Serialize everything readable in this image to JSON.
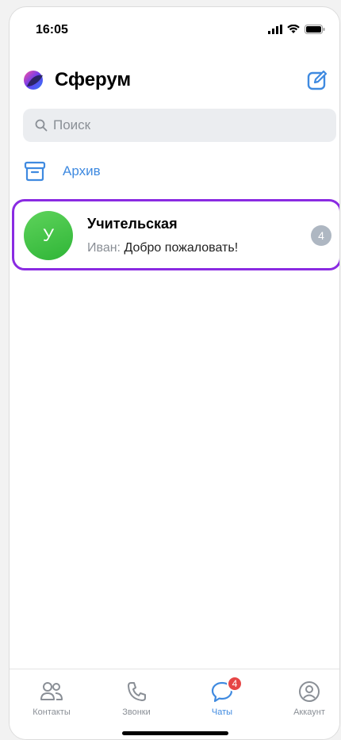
{
  "status_bar": {
    "time": "16:05"
  },
  "header": {
    "title": "Сферум",
    "logo_icon": "sferum-logo",
    "compose_icon": "compose-icon"
  },
  "search": {
    "placeholder": "Поиск"
  },
  "archive": {
    "label": "Архив"
  },
  "chats": [
    {
      "avatar_letter": "У",
      "title": "Учительская",
      "sender": "Иван:",
      "message": "Добро пожаловать!",
      "unread": "4",
      "highlighted": true
    }
  ],
  "tabbar": {
    "tabs": [
      {
        "label": "Контакты",
        "icon": "contacts-icon"
      },
      {
        "label": "Звонки",
        "icon": "phone-icon"
      },
      {
        "label": "Чаты",
        "icon": "chat-icon",
        "badge": "4",
        "active": true
      },
      {
        "label": "Аккаунт",
        "icon": "account-icon"
      }
    ]
  },
  "colors": {
    "accent": "#3f8ae0",
    "highlight": "#8a2be2",
    "avatar": "#3cc043",
    "badge_red": "#e64646"
  }
}
